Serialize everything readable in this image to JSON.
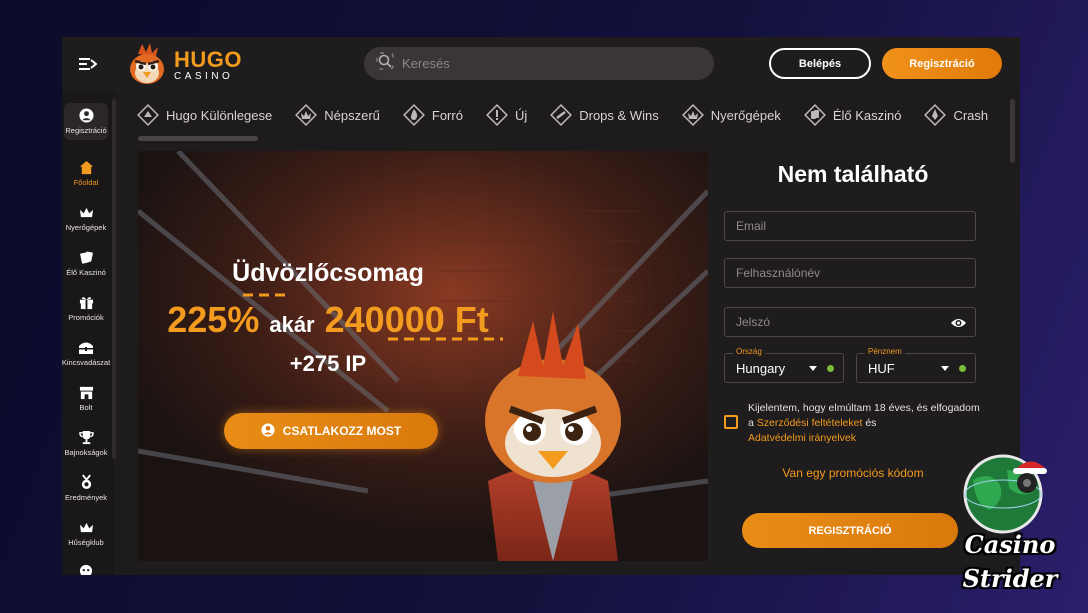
{
  "header": {
    "logo_title": "HUGO",
    "logo_subtitle": "CASINO",
    "search_placeholder": "Keresés",
    "login_label": "Belépés",
    "register_label": "Regisztráció"
  },
  "sidebar": {
    "items": [
      {
        "label": "Regisztráció",
        "icon": "user-icon"
      },
      {
        "label": "Főoldal",
        "icon": "home-icon"
      },
      {
        "label": "Nyerőgépek",
        "icon": "crown-icon"
      },
      {
        "label": "Élő Kaszinó",
        "icon": "cards-icon"
      },
      {
        "label": "Promóciók",
        "icon": "gift-icon"
      },
      {
        "label": "Kincsvadászat",
        "icon": "treasure-chest-icon"
      },
      {
        "label": "Bolt",
        "icon": "shop-icon"
      },
      {
        "label": "Bajnokságok",
        "icon": "trophy-icon"
      },
      {
        "label": "Eredmények",
        "icon": "medal-icon"
      },
      {
        "label": "Hűségklub",
        "icon": "crown-icon"
      }
    ]
  },
  "categories": [
    {
      "label": "Hugo Különlegese",
      "icon": "special-icon"
    },
    {
      "label": "Népszerű",
      "icon": "popular-icon"
    },
    {
      "label": "Forró",
      "icon": "fire-icon"
    },
    {
      "label": "Új",
      "icon": "new-icon"
    },
    {
      "label": "Drops & Wins",
      "icon": "drops-icon"
    },
    {
      "label": "Nyerőgépek",
      "icon": "slots-icon"
    },
    {
      "label": "Élő Kaszinó",
      "icon": "live-casino-icon"
    },
    {
      "label": "Crash",
      "icon": "crash-icon"
    }
  ],
  "banner": {
    "title": "Üdvözlőcsomag",
    "percent": "225%",
    "middle": "akár",
    "amount": "240000 Ft",
    "plus": "+275 IP",
    "cta": "CSATLAKOZZ MOST"
  },
  "form": {
    "title": "Nem található",
    "email_placeholder": "Email",
    "username_placeholder": "Felhasználónév",
    "password_placeholder": "Jelszó",
    "country_label": "Ország",
    "country_value": "Hungary",
    "currency_label": "Pénznem",
    "currency_value": "HUF",
    "consent_text_1": "Kijelentem, hogy elmúltam 18 éves, és elfogadom a ",
    "consent_link_1": "Szerződési feltételeket",
    "consent_text_2": " és ",
    "consent_link_2": "Adatvédelmi irányelvek",
    "promo_link": "Van egy promóciós kódom",
    "submit_label": "REGISZTRÁCIÓ"
  },
  "watermark": {
    "line1": "Casino",
    "line2": "Strider"
  },
  "colors": {
    "accent": "#f29b1e",
    "panel": "#1f1c1d",
    "status_dot": "#7bbd3a"
  }
}
